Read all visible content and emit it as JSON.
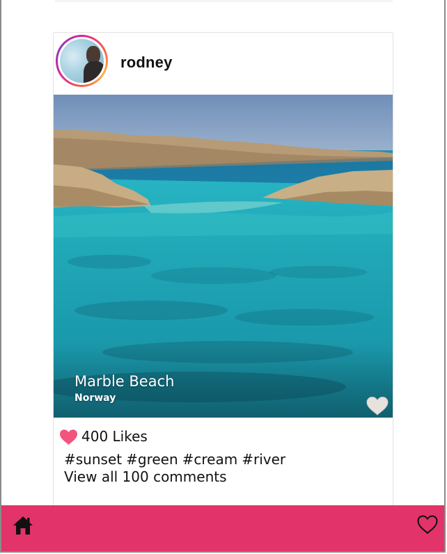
{
  "post": {
    "username": "rodney",
    "avatar_icon": "profile-photo-avatar",
    "photo": {
      "title": "Marble Beach",
      "location": "Norway",
      "overlay_icon": "heart-icon",
      "overlay_icon_color": "#e8e2de"
    },
    "likes": {
      "icon": "heart-icon",
      "icon_color": "#f2547e",
      "label": "400 Likes"
    },
    "tags": [
      "#sunset",
      "#green",
      "#cream",
      "#river"
    ],
    "comments_label": "View all 100 comments"
  },
  "bottom_nav": {
    "background": "#e2336b",
    "left_icon": "home-icon",
    "right_icon": "heart-outline-icon"
  }
}
